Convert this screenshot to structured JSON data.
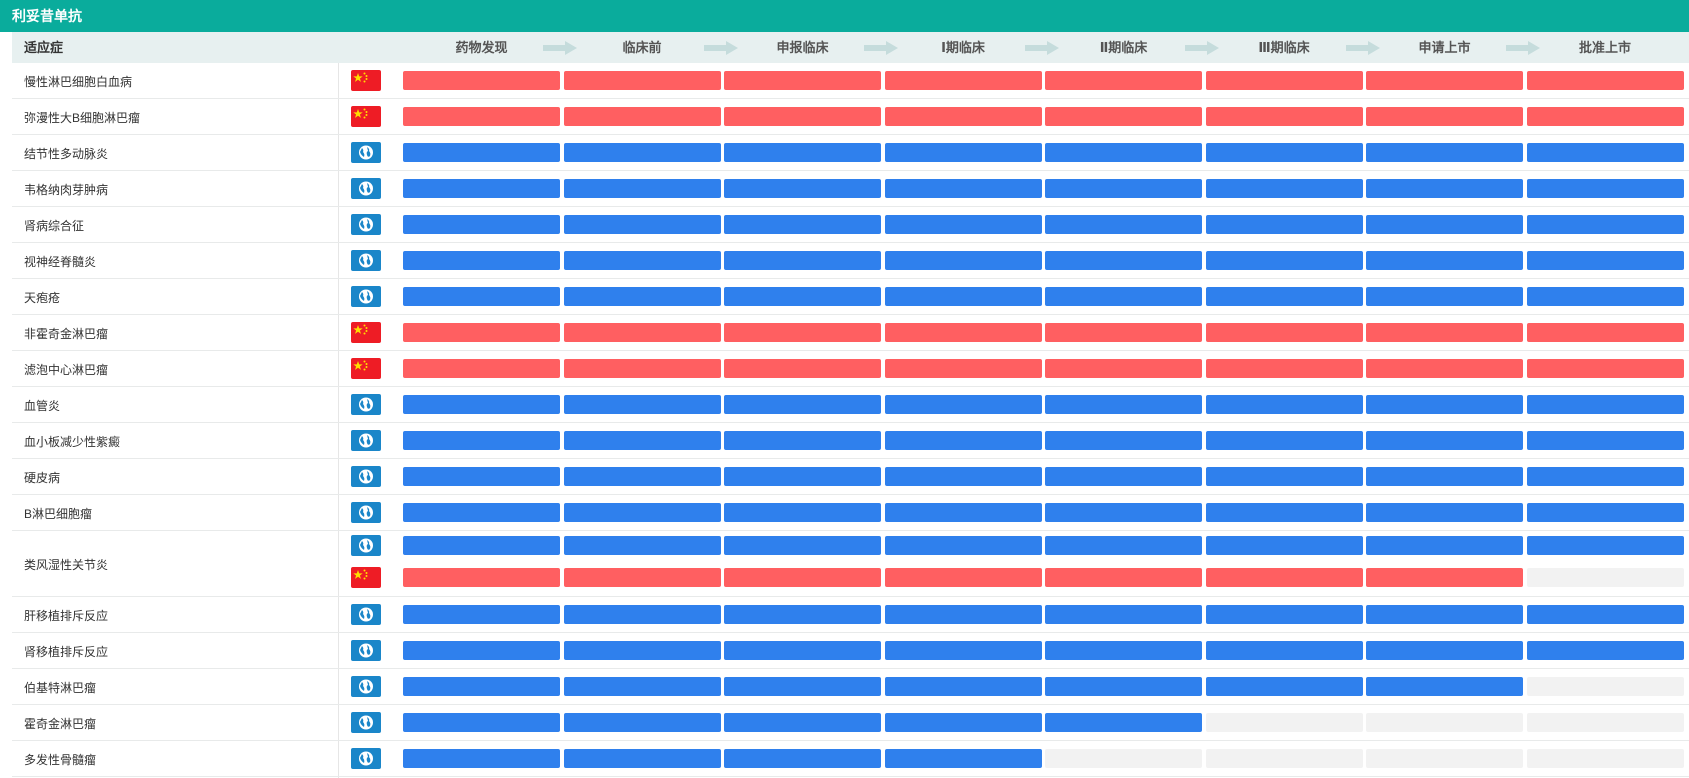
{
  "title": "利妥昔单抗",
  "header": {
    "indication_label": "适应症",
    "stages": [
      "药物发现",
      "临床前",
      "申报临床",
      "Ⅰ期临床",
      "Ⅱ期临床",
      "Ⅲ期临床",
      "申请上市",
      "批准上市"
    ]
  },
  "legend_colors": {
    "china": "#ff5f61",
    "global": "#2f80ed",
    "empty": "#f2f2f2",
    "cn_flag": "#ee1c25",
    "global_flag": "#1a86c9"
  },
  "rows": [
    {
      "name": "慢性淋巴细胞白血病",
      "tracks": [
        {
          "region": "china",
          "stages_reached": 8
        }
      ]
    },
    {
      "name": "弥漫性大B细胞淋巴瘤",
      "tracks": [
        {
          "region": "china",
          "stages_reached": 8
        }
      ]
    },
    {
      "name": "结节性多动脉炎",
      "tracks": [
        {
          "region": "global",
          "stages_reached": 8
        }
      ]
    },
    {
      "name": "韦格纳肉芽肿病",
      "tracks": [
        {
          "region": "global",
          "stages_reached": 8
        }
      ]
    },
    {
      "name": "肾病综合征",
      "tracks": [
        {
          "region": "global",
          "stages_reached": 8
        }
      ]
    },
    {
      "name": "视神经脊髓炎",
      "tracks": [
        {
          "region": "global",
          "stages_reached": 8
        }
      ]
    },
    {
      "name": "天疱疮",
      "tracks": [
        {
          "region": "global",
          "stages_reached": 8
        }
      ]
    },
    {
      "name": "非霍奇金淋巴瘤",
      "tracks": [
        {
          "region": "china",
          "stages_reached": 8
        }
      ]
    },
    {
      "name": "滤泡中心淋巴瘤",
      "tracks": [
        {
          "region": "china",
          "stages_reached": 8
        }
      ]
    },
    {
      "name": "血管炎",
      "tracks": [
        {
          "region": "global",
          "stages_reached": 8
        }
      ]
    },
    {
      "name": "血小板减少性紫癜",
      "tracks": [
        {
          "region": "global",
          "stages_reached": 8
        }
      ]
    },
    {
      "name": "硬皮病",
      "tracks": [
        {
          "region": "global",
          "stages_reached": 8
        }
      ]
    },
    {
      "name": "B淋巴细胞瘤",
      "tracks": [
        {
          "region": "global",
          "stages_reached": 8
        }
      ]
    },
    {
      "name": "类风湿性关节炎",
      "tracks": [
        {
          "region": "global",
          "stages_reached": 8
        },
        {
          "region": "china",
          "stages_reached": 7
        }
      ]
    },
    {
      "name": "肝移植排斥反应",
      "tracks": [
        {
          "region": "global",
          "stages_reached": 8
        }
      ]
    },
    {
      "name": "肾移植排斥反应",
      "tracks": [
        {
          "region": "global",
          "stages_reached": 8
        }
      ]
    },
    {
      "name": "伯基特淋巴瘤",
      "tracks": [
        {
          "region": "global",
          "stages_reached": 7
        }
      ]
    },
    {
      "name": "霍奇金淋巴瘤",
      "tracks": [
        {
          "region": "global",
          "stages_reached": 5
        }
      ]
    },
    {
      "name": "多发性骨髓瘤",
      "tracks": [
        {
          "region": "global",
          "stages_reached": 4
        }
      ]
    }
  ]
}
